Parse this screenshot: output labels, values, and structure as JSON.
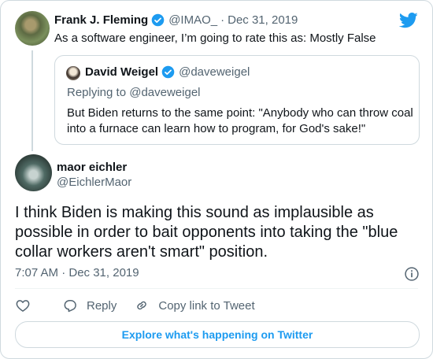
{
  "colors": {
    "accent": "#1d9bf0",
    "muted": "#536471",
    "text": "#0f1419",
    "border": "#cfd9de"
  },
  "parent_tweet": {
    "name": "Frank J. Fleming",
    "handle": "@IMAO_",
    "separator": "·",
    "date": "Dec 31, 2019",
    "text": "As a software engineer, I’m going to rate this as: Mostly False"
  },
  "quoted_tweet": {
    "name": "David Weigel",
    "handle": "@daveweigel",
    "replying_to": "Replying to @daveweigel",
    "text": "But Biden returns to the same point: \"Anybody who can throw coal into a furnace can learn how to program, for God's sake!\""
  },
  "main_tweet": {
    "name": "maor eichler",
    "handle": "@EichlerMaor",
    "text": "I think Biden is making this sound as implausible as possible in order to bait opponents into taking the \"blue collar workers aren't smart\" position.",
    "timestamp": "7:07 AM · Dec 31, 2019"
  },
  "actions": {
    "reply_label": "Reply",
    "copy_link_label": "Copy link to Tweet"
  },
  "explore_button_label": "Explore what's happening on Twitter",
  "icons": [
    "twitter-bird-icon",
    "verified-badge-icon",
    "info-icon",
    "heart-icon",
    "reply-icon",
    "link-icon"
  ]
}
